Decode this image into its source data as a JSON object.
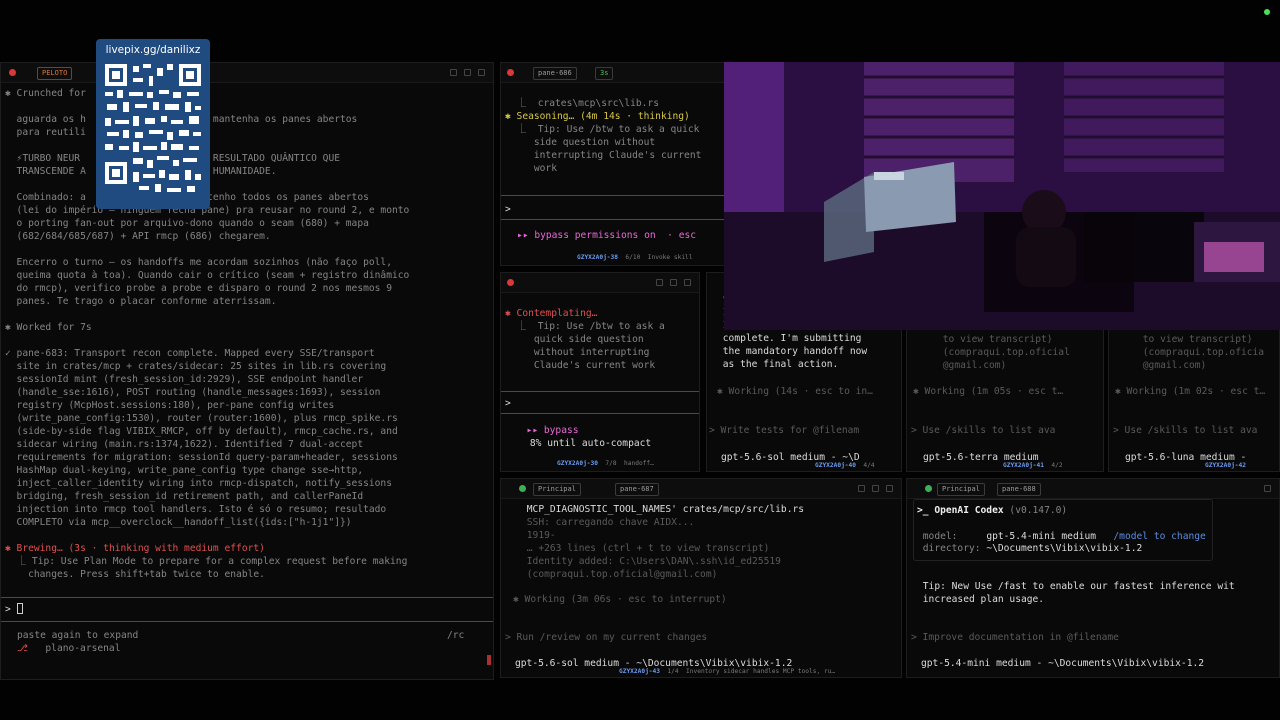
{
  "overlay": {
    "donation_label": "livepix.gg/danilixz"
  },
  "pane_left": {
    "badge": "PELOTO",
    "lines": [
      {
        "cls": "dim",
        "text": "✱ Crunched for"
      },
      {
        "cls": "dim",
        "text": "  aguarda os h             round 2, mantenha os panes abertos"
      },
      {
        "cls": "dim",
        "text": "  para reutili"
      },
      {
        "cls": "dim",
        "text": "  ⚡TURBO NEUR            ARADO PARA RESULTADO QUÂNTICO QUE"
      },
      {
        "cls": "dim",
        "text": "  TRANSCENDE A             ATUAL DA HUMANIDADE."
      },
      {
        "cls": "dim",
        "text": "  Combinado: a            offs, mantenho todos os panes abertos"
      },
      {
        "cls": "dim",
        "text": "  (lei do império — ninguém fecha pane) pra reusar no round 2, e monto"
      },
      {
        "cls": "dim",
        "text": "  o porting fan-out por arquivo-dono quando o seam (680) + mapa"
      },
      {
        "cls": "dim",
        "text": "  (682/684/685/687) + API rmcp (686) chegarem."
      },
      {
        "cls": "dim",
        "text": "  Encerro o turno — os handoffs me acordam sozinhos (não faço poll,"
      },
      {
        "cls": "dim",
        "text": "  queima quota à toa). Quando cair o crítico (seam + registro dinâmico"
      },
      {
        "cls": "dim",
        "text": "  do rmcp), verifico probe a probe e disparo o round 2 nos mesmos 9"
      },
      {
        "cls": "dim",
        "text": "  panes. Te trago o placar conforme aterrissam."
      },
      {
        "cls": "dim",
        "text": "✱ Worked for 7s"
      },
      {
        "cls": "dim",
        "text": "✓ pane-683: Transport recon complete. Mapped every SSE/transport"
      },
      {
        "cls": "dim",
        "text": "  site in crates/mcp + crates/sidecar: 25 sites in lib.rs covering"
      },
      {
        "cls": "dim",
        "text": "  sessionId mint (fresh_session_id:2929), SSE endpoint handler"
      },
      {
        "cls": "dim",
        "text": "  (handle_sse:1616), POST routing (handle_messages:1693), session"
      },
      {
        "cls": "dim",
        "text": "  registry (McpHost.sessions:180), per-pane config writes"
      },
      {
        "cls": "dim",
        "text": "  (write_pane_config:1530), router (router:1600), plus rmcp_spike.rs"
      },
      {
        "cls": "dim",
        "text": "  (side-by-side flag VIBIX_RMCP, off by default), rmcp_cache.rs, and"
      },
      {
        "cls": "dim",
        "text": "  sidecar wiring (main.rs:1374,1622). Identified 7 dual-accept"
      },
      {
        "cls": "dim",
        "text": "  requirements for migration: sessionId query-param+header, sessions"
      },
      {
        "cls": "dim",
        "text": "  HashMap dual-keying, write_pane_config type change sse→http,"
      },
      {
        "cls": "dim",
        "text": "  inject_caller_identity wiring into rmcp-dispatch, notify_sessions"
      },
      {
        "cls": "dim",
        "text": "  bridging, fresh_session_id retirement path, and callerPaneId"
      },
      {
        "cls": "dim",
        "text": "  injection into rmcp tool handlers. Isto é só o resumo; resultado"
      },
      {
        "cls": "dim",
        "text": "  COMPLETO via mcp__overclock__handoff_list({ids:[\"h-1j1\"]})"
      },
      {
        "cls": "red",
        "text": "✱ Brewing… (3s · thinking with medium effort)"
      },
      {
        "cls": "dim",
        "text": "  ⎿ Tip: Use Plan Mode to prepare for a complex request before making"
      },
      {
        "cls": "dim",
        "text": "    changes. Press shift+tab twice to enable."
      }
    ],
    "prompt": "> ",
    "footer_1": "paste again to expand",
    "footer_cmd": "/rc",
    "footer_2": "   plano-arsenal"
  },
  "pane_tm": {
    "tag1": "pane-686",
    "tag2": "3s",
    "lines": [
      {
        "cls": "dim",
        "text": "  ⎿  crates\\mcp\\src\\lib.rs"
      },
      {
        "cls": "yel",
        "text": "✱ Seasoning… (4m 14s · thinking)"
      },
      {
        "cls": "dim",
        "text": "  ⎿  Tip: Use /btw to ask a quick"
      },
      {
        "cls": "dim",
        "text": "     side question without"
      },
      {
        "cls": "dim",
        "text": "     interrupting Claude's current"
      },
      {
        "cls": "dim",
        "text": "     work"
      }
    ],
    "prompt": ">",
    "bypass": "▸▸ bypass permissions on  · esc",
    "status_id": "GZYX2A0j-38",
    "status_rest": "  6/10  Invoke skill"
  },
  "pane_ml": {
    "lines": [
      {
        "cls": "red",
        "text": "✱ Contemplating…"
      },
      {
        "cls": "dim",
        "text": "  ⎿  Tip: Use /btw to ask a"
      },
      {
        "cls": "dim",
        "text": "     quick side question"
      },
      {
        "cls": "dim",
        "text": "     without interrupting"
      },
      {
        "cls": "dim",
        "text": "     Claude's current work"
      }
    ],
    "prompt": ">",
    "bypass": "  ▸▸ bypass",
    "autocompact": "     8% until auto-compact",
    "status_id": "GZYX2A0j-30",
    "status_rest": "  7/8  handoff…"
  },
  "pane_m2": {
    "lines": [
      {
        "cls": "dim",
        "text": " v"
      },
      {
        "cls": "dim",
        "text": " I"
      },
      {
        "cls": "dim",
        "text": " I"
      },
      {
        "cls": "w",
        "text": " complete. I'm submitting"
      },
      {
        "cls": "w",
        "text": " the mandatory handoff now"
      },
      {
        "cls": "w",
        "text": " as the final action."
      }
    ],
    "working": "✱ Working (14s · esc to in…",
    "input": "> Write tests for @filenam",
    "model": "gpt-5.6-sol medium - ~\\D",
    "status_id": "GZYX2A0j-40",
    "status_rest": "  4/4"
  },
  "pane_m3": {
    "lines": [
      {
        "cls": "faint",
        "text": " to view transcript)"
      },
      {
        "cls": "faint",
        "text": " (compraqui.top.oficial"
      },
      {
        "cls": "faint",
        "text": " @gmail.com)"
      }
    ],
    "working": "✱ Working (1m 05s · esc t…",
    "input": "> Use /skills to list ava",
    "model": "gpt-5.6-terra medium",
    "status_id": "GZYX2A0j-41",
    "status_rest": "  4/2"
  },
  "pane_m4": {
    "lines": [
      {
        "cls": "faint",
        "text": " to view transcript)"
      },
      {
        "cls": "faint",
        "text": " (compraqui.top.oficia"
      },
      {
        "cls": "faint",
        "text": " @gmail.com)"
      }
    ],
    "working": "✱ Working (1m 02s · esc t…",
    "input": "> Use /skills to list ava",
    "model": "gpt-5.6-luna medium -",
    "status_id": "GZYX2A0j-42",
    "status_rest": ""
  },
  "pane_bm": {
    "tag1": "Principal",
    "tag2": "pane-687",
    "lines": [
      {
        "cls": "w",
        "text": " MCP_DIAGNOSTIC_TOOL_NAMES' crates/mcp/src/lib.rs"
      },
      {
        "cls": "faint",
        "text": " SSH: carregando chave AIDX..."
      },
      {
        "cls": "faint",
        "text": " 1919-"
      },
      {
        "cls": "faint",
        "text": " … +263 lines (ctrl + t to view transcript)"
      },
      {
        "cls": "faint",
        "text": " Identity added: C:\\Users\\DAN\\.ssh\\id_ed25519"
      },
      {
        "cls": "faint",
        "text": " (compraqui.top.oficial@gmail.com)"
      }
    ],
    "working": "✱ Working (3m 06s · esc to interrupt)",
    "input": "> Run /review on my current changes",
    "model": "gpt-5.6-sol medium - ~\\Documents\\Vibix\\vibix-1.2",
    "status_id": "GZYX2A0j-43",
    "status_rest": "  1/4  Inventory sidecar handles MCP tools, ru…"
  },
  "pane_br": {
    "tag1": "Principal",
    "tag2": "pane-688",
    "codex_title": ">_ OpenAI Codex",
    "codex_version": " (v0.147.0)",
    "model_label": " model:     ",
    "model_value": "gpt-5.4-mini medium",
    "model_hint": "   /model to change",
    "dir_label": " directory: ",
    "dir_value": "~\\Documents\\Vibix\\vibix-1.2",
    "tip_1": " Tip: New Use /fast to enable our fastest inference wit",
    "tip_2": " increased plan usage.",
    "input": "> Improve documentation in @filename",
    "model": "gpt-5.4-mini medium - ~\\Documents\\Vibix\\vibix-1.2"
  },
  "colors": {
    "accent_red": "#e05050",
    "accent_magenta": "#e868d8",
    "status_blue": "#6a9cf0",
    "qr_bg": "#1f4b80"
  }
}
